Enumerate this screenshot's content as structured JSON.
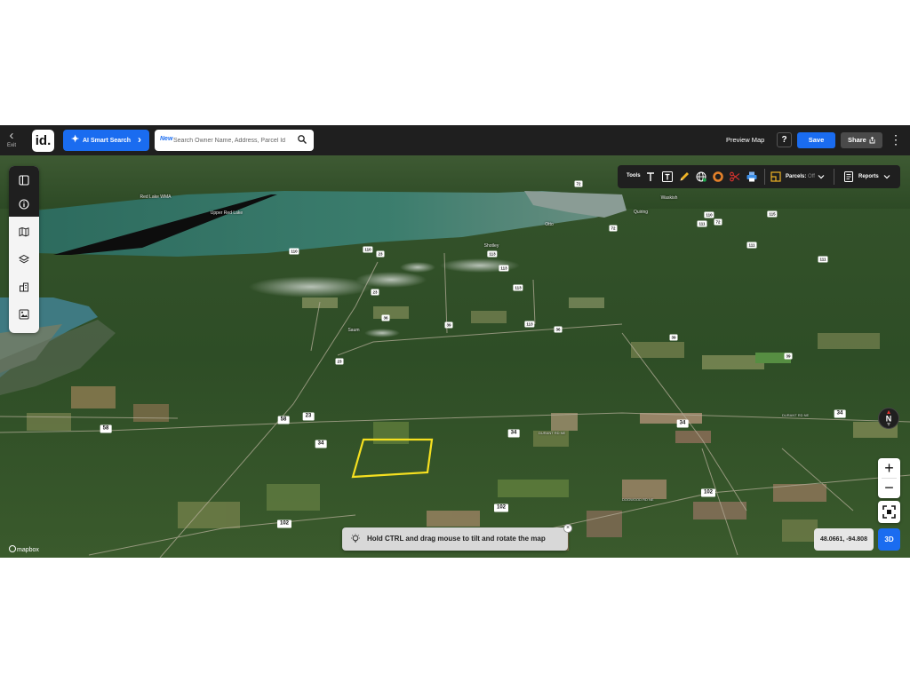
{
  "topbar": {
    "exit_label": "Exit",
    "logo_text": "id.",
    "ai_search_label": "AI Smart Search",
    "search_badge": "New",
    "search_placeholder": "Search Owner Name, Address, Parcel Id",
    "preview_label": "Preview Map",
    "help_label": "?",
    "save_label": "Save",
    "share_label": "Share"
  },
  "sidebar": {
    "items": [
      {
        "icon": "panel-icon"
      },
      {
        "icon": "info-icon"
      },
      {
        "icon": "map-icon"
      },
      {
        "icon": "layers-icon"
      },
      {
        "icon": "buildings-icon"
      },
      {
        "icon": "image-icon"
      }
    ]
  },
  "tools": {
    "label": "Tools",
    "icons": [
      "text-icon",
      "text-box-icon",
      "pencil-icon",
      "globe-icon",
      "circle-icon",
      "scissors-icon",
      "print-icon"
    ],
    "parcels_label": "Parcels:",
    "parcels_state": "Off",
    "reports_label": "Reports"
  },
  "map": {
    "places": [
      "Upper Red Lake",
      "Waskish",
      "Shotley",
      "Saum",
      "Otto",
      "Red Lake WMA",
      "Quiring"
    ],
    "roads": [
      "72",
      "113",
      "110",
      "111",
      "115",
      "23",
      "36",
      "39",
      "58",
      "34",
      "102",
      "16"
    ],
    "road_names": [
      "DOGWOOD RD NE",
      "DURANT RD NE"
    ],
    "compass_label": "N",
    "coordinates": "48.0661, -94.808",
    "mode_3d_label": "3D",
    "hint_text": "Hold CTRL and drag mouse to tilt and rotate the map",
    "attribution": "mapbox",
    "colors": {
      "accent": "#1a6cf0",
      "parcel_outline": "#f5e020",
      "toolbar": "#1f1f1f"
    }
  }
}
